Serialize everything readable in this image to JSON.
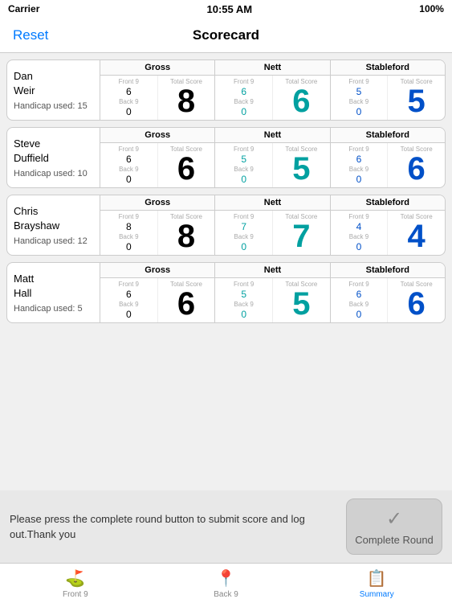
{
  "statusBar": {
    "carrier": "Carrier",
    "wifi": true,
    "time": "10:55 AM",
    "battery": "100%"
  },
  "navBar": {
    "title": "Scorecard",
    "resetLabel": "Reset"
  },
  "players": [
    {
      "name": "Dan\nWeir",
      "handicap": "Handicap used: 15",
      "gross": {
        "header": "Gross",
        "frontLabel": "Front 9",
        "frontVal": "6",
        "backLabel": "Back 9",
        "backVal": "0",
        "totalLabel": "Total Score",
        "totalVal": "8"
      },
      "nett": {
        "header": "Nett",
        "frontLabel": "Front 9",
        "frontVal": "6",
        "backLabel": "Back 9",
        "backVal": "0",
        "totalLabel": "Total Score",
        "totalVal": "6"
      },
      "stableford": {
        "header": "Stableford",
        "frontLabel": "Front 9",
        "frontVal": "5",
        "backLabel": "Back 9",
        "backVal": "0",
        "totalLabel": "Total Score",
        "totalVal": "5"
      }
    },
    {
      "name": "Steve\nDuffield",
      "handicap": "Handicap used: 10",
      "gross": {
        "header": "Gross",
        "frontLabel": "Front 9",
        "frontVal": "6",
        "backLabel": "Back 9",
        "backVal": "0",
        "totalLabel": "Total Score",
        "totalVal": "6"
      },
      "nett": {
        "header": "Nett",
        "frontLabel": "Front 9",
        "frontVal": "5",
        "backLabel": "Back 9",
        "backVal": "0",
        "totalLabel": "Total Score",
        "totalVal": "5"
      },
      "stableford": {
        "header": "Stableford",
        "frontLabel": "Front 9",
        "frontVal": "6",
        "backLabel": "Back 9",
        "backVal": "0",
        "totalLabel": "Total Score",
        "totalVal": "6"
      }
    },
    {
      "name": "Chris\nBrayshaw",
      "handicap": "Handicap used: 12",
      "gross": {
        "header": "Gross",
        "frontLabel": "Front 9",
        "frontVal": "8",
        "backLabel": "Back 9",
        "backVal": "0",
        "totalLabel": "Total Score",
        "totalVal": "8"
      },
      "nett": {
        "header": "Nett",
        "frontLabel": "Front 9",
        "frontVal": "7",
        "backLabel": "Back 9",
        "backVal": "0",
        "totalLabel": "Total Score",
        "totalVal": "7"
      },
      "stableford": {
        "header": "Stableford",
        "frontLabel": "Front 9",
        "frontVal": "4",
        "backLabel": "Back 9",
        "backVal": "0",
        "totalLabel": "Total Score",
        "totalVal": "4"
      }
    },
    {
      "name": "Matt\nHall",
      "handicap": "Handicap used: 5",
      "gross": {
        "header": "Gross",
        "frontLabel": "Front 9",
        "frontVal": "6",
        "backLabel": "Back 9",
        "backVal": "0",
        "totalLabel": "Total Score",
        "totalVal": "6"
      },
      "nett": {
        "header": "Nett",
        "frontLabel": "Front 9",
        "frontVal": "5",
        "backLabel": "Back 9",
        "backVal": "0",
        "totalLabel": "Total Score",
        "totalVal": "5"
      },
      "stableford": {
        "header": "Stableford",
        "frontLabel": "Front 9",
        "frontVal": "6",
        "backLabel": "Back 9",
        "backVal": "0",
        "totalLabel": "Total Score",
        "totalVal": "6"
      }
    }
  ],
  "bottomArea": {
    "instruction": "Please press the complete round button to submit score and log out.Thank you",
    "completeRound": "Complete Round"
  },
  "tabBar": {
    "tabs": [
      {
        "icon": "⛳",
        "label": "Front 9",
        "active": false
      },
      {
        "icon": "📍",
        "label": "Back 9",
        "active": false
      },
      {
        "icon": "📋",
        "label": "Summary",
        "active": true
      }
    ]
  }
}
